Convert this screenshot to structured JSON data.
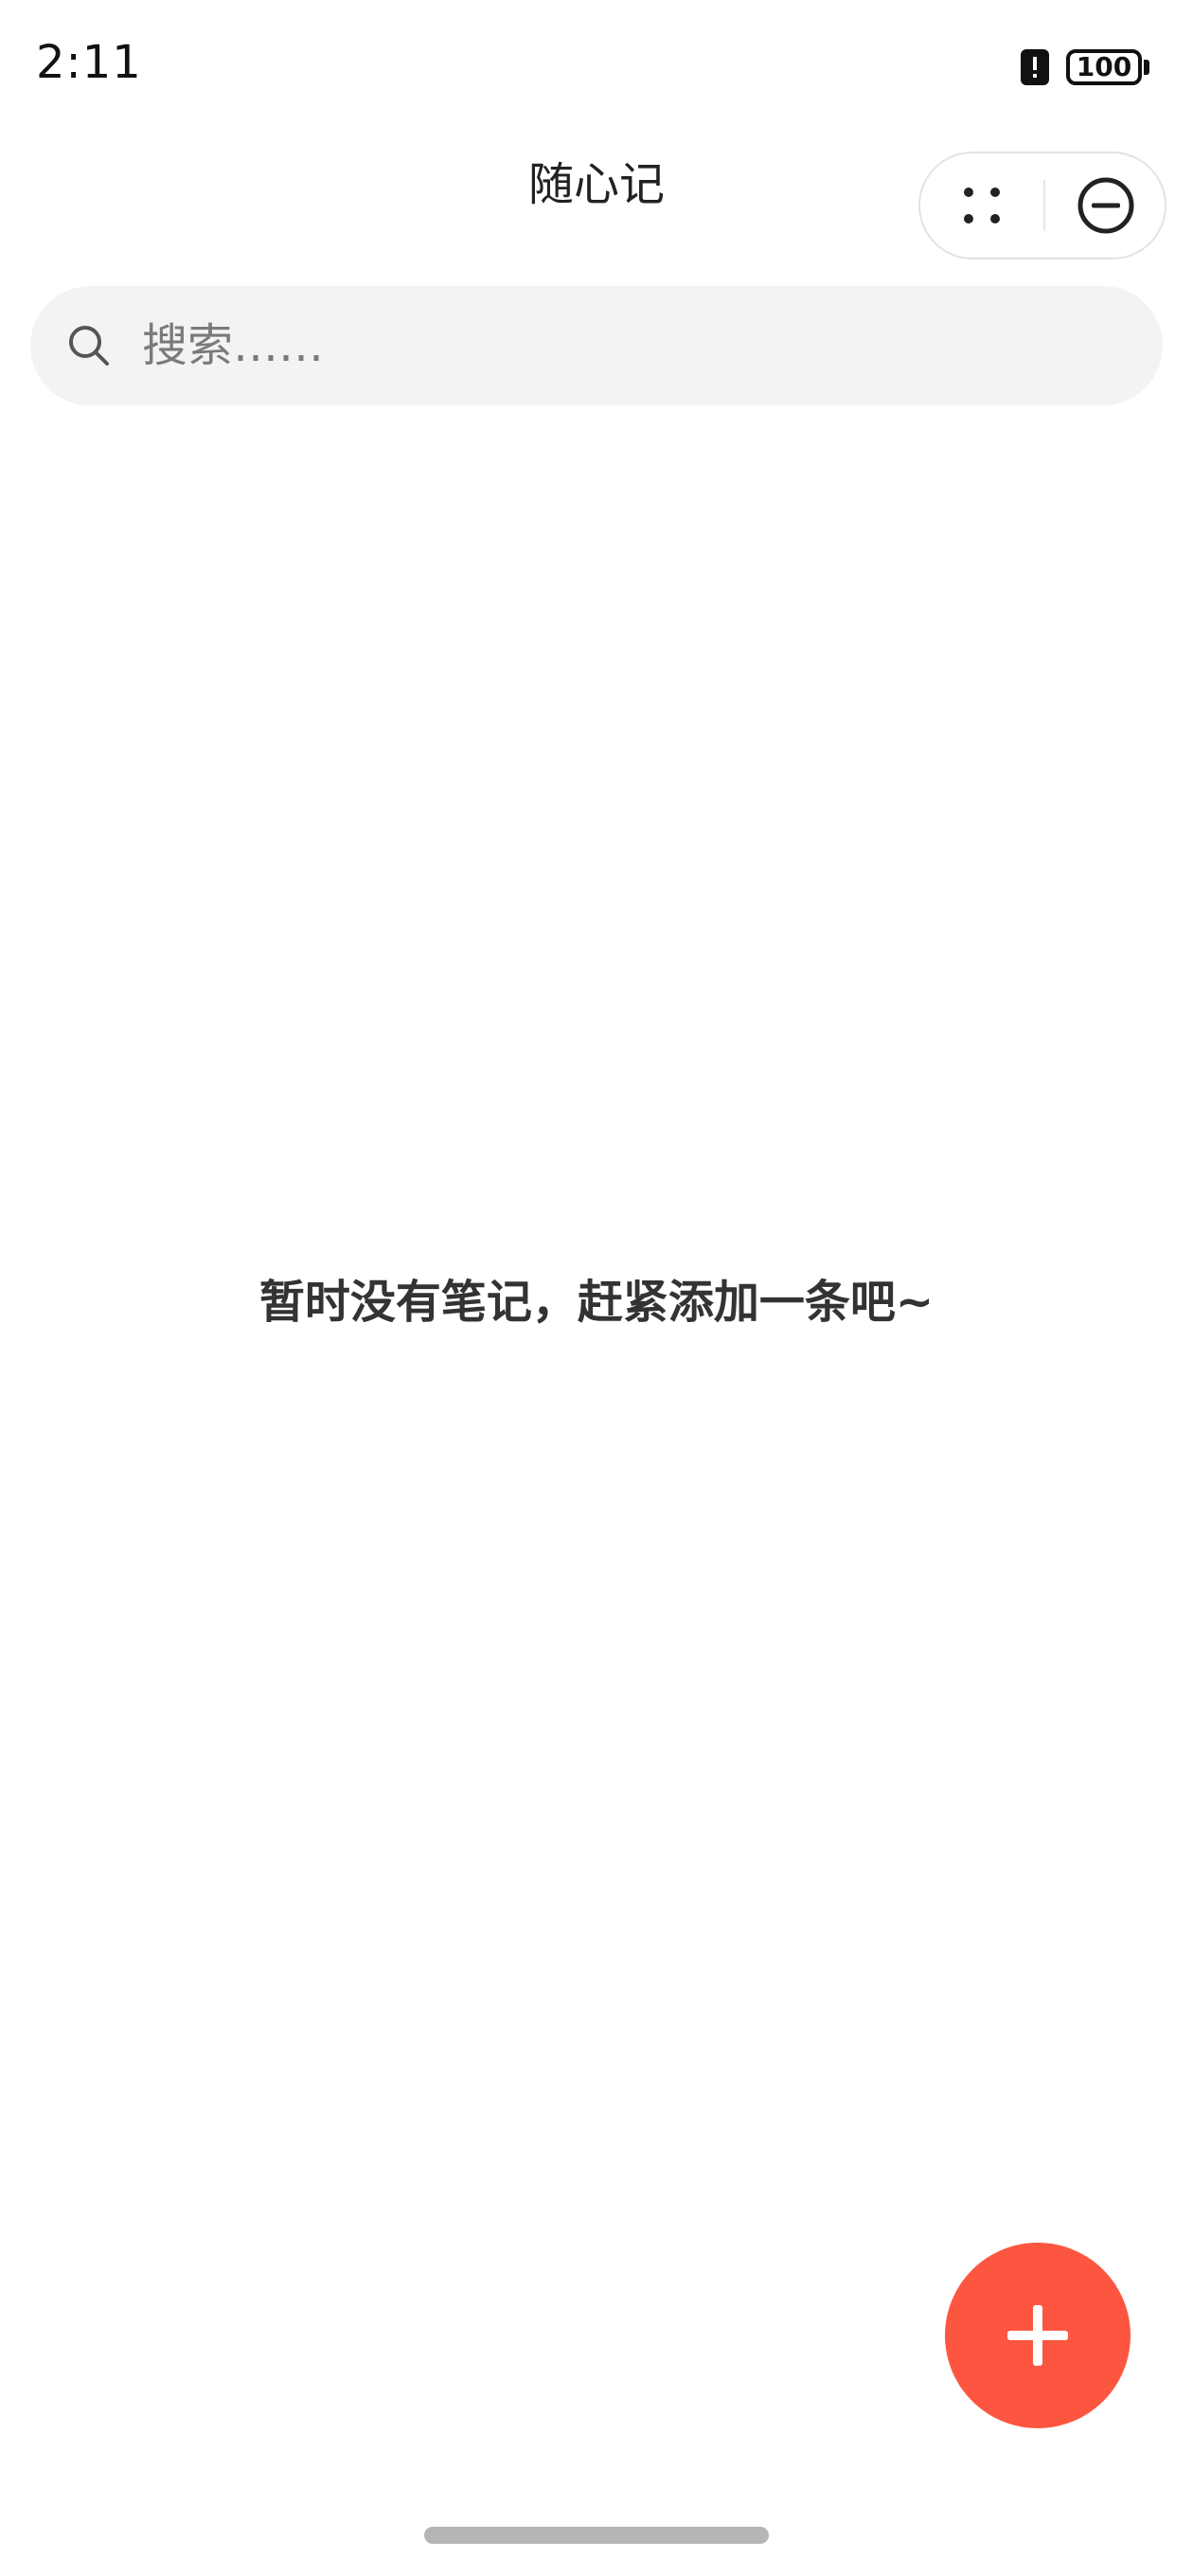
{
  "status_bar": {
    "time": "2:11",
    "battery": "100",
    "alert_icon": "alert-badge-icon"
  },
  "nav": {
    "title": "随心记",
    "more_icon": "more-dots-icon",
    "close_icon": "minus-circle-icon"
  },
  "search": {
    "placeholder": "搜索……",
    "value": "",
    "icon": "search-icon"
  },
  "empty_state": {
    "message": "暂时没有笔记，赶紧添加一条吧~"
  },
  "fab": {
    "icon": "plus-icon",
    "color": "#fd5640"
  }
}
